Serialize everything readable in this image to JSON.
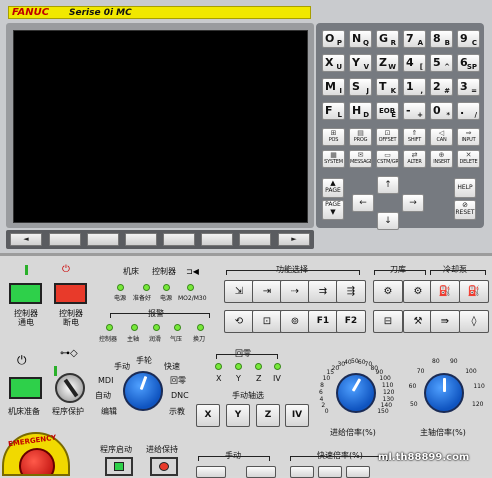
{
  "brand": {
    "name": "FANUC",
    "series": "Serise 0i MC"
  },
  "soft_keys": [
    "◄",
    "",
    "",
    "",
    "",
    "",
    "",
    "►"
  ],
  "address_keys": [
    {
      "m": "O",
      "s": "P"
    },
    {
      "m": "N",
      "s": "Q"
    },
    {
      "m": "G",
      "s": "R"
    },
    {
      "m": "7",
      "s": "A"
    },
    {
      "m": "8",
      "s": "B"
    },
    {
      "m": "9",
      "s": "C"
    },
    {
      "m": "X",
      "s": "U"
    },
    {
      "m": "Y",
      "s": "V"
    },
    {
      "m": "Z",
      "s": "W"
    },
    {
      "m": "4",
      "s": "["
    },
    {
      "m": "5",
      "s": "^"
    },
    {
      "m": "6",
      "s": "SP"
    },
    {
      "m": "M",
      "s": "I"
    },
    {
      "m": "S",
      "s": "J"
    },
    {
      "m": "T",
      "s": "K"
    },
    {
      "m": "1",
      "s": ","
    },
    {
      "m": "2",
      "s": "#"
    },
    {
      "m": "3",
      "s": "="
    },
    {
      "m": "F",
      "s": "L"
    },
    {
      "m": "H",
      "s": "D"
    },
    {
      "m": "EOB",
      "s": "E"
    },
    {
      "m": "-",
      "s": "+"
    },
    {
      "m": "0",
      "s": "*"
    },
    {
      "m": ".",
      "s": "/"
    }
  ],
  "func_keys": [
    "POS",
    "PROG",
    "OFFSET",
    "SHIFT",
    "CAN",
    "INPUT",
    "SYSTEM",
    "MESSAGE",
    "CSTM/GR",
    "ALTER",
    "INSERT",
    "DELETE"
  ],
  "page_up": "PAGE",
  "page_down": "PAGE",
  "help": "HELP",
  "reset": "RESET",
  "panel": {
    "ctrl_power_on": "控制器通电",
    "ctrl_power_off": "控制器断电",
    "machine_lbl": "机床",
    "controller_lbl": "控制器",
    "status_leds": [
      "电源",
      "准备好",
      "电源",
      "MO2/M30"
    ],
    "alarm_lbl": "报警",
    "alarm_leds": [
      "控制器",
      "主轴",
      "润滑",
      "气压",
      "换刀"
    ],
    "func_select": "功能选择",
    "tool_mag": "刀库",
    "coolant": "冷却泵",
    "f1": "F1",
    "f2": "F2",
    "machine_ready": "机床准备",
    "program_protect": "程序保护",
    "mode_labels": [
      "手动",
      "手轮",
      "快速",
      "MDI",
      "回零",
      "自动",
      "DNC",
      "编辑",
      "示教"
    ],
    "home_lbl": "回零",
    "home_axes": [
      "X",
      "Y",
      "Z",
      "IV"
    ],
    "jog_axis_lbl": "手动轴选",
    "jog_axes": [
      "X",
      "Y",
      "Z",
      "IV"
    ],
    "feed_override": "进给倍率(%)",
    "spindle_override": "主轴倍率(%)",
    "feed_scale": [
      "0",
      "2",
      "4",
      "6",
      "8",
      "10",
      "15",
      "20",
      "30",
      "40",
      "50",
      "60",
      "70",
      "80",
      "90",
      "100",
      "110",
      "120",
      "130",
      "140",
      "150"
    ],
    "spindle_scale": [
      "50",
      "60",
      "70",
      "80",
      "90",
      "100",
      "110",
      "120"
    ],
    "emergency": "EMERGENCY",
    "cycle_start": "程序启动",
    "feed_hold": "进给保持",
    "manual": "手动",
    "rapid_override": "快速倍率(%)",
    "watermark": "ml.th88899.com"
  }
}
